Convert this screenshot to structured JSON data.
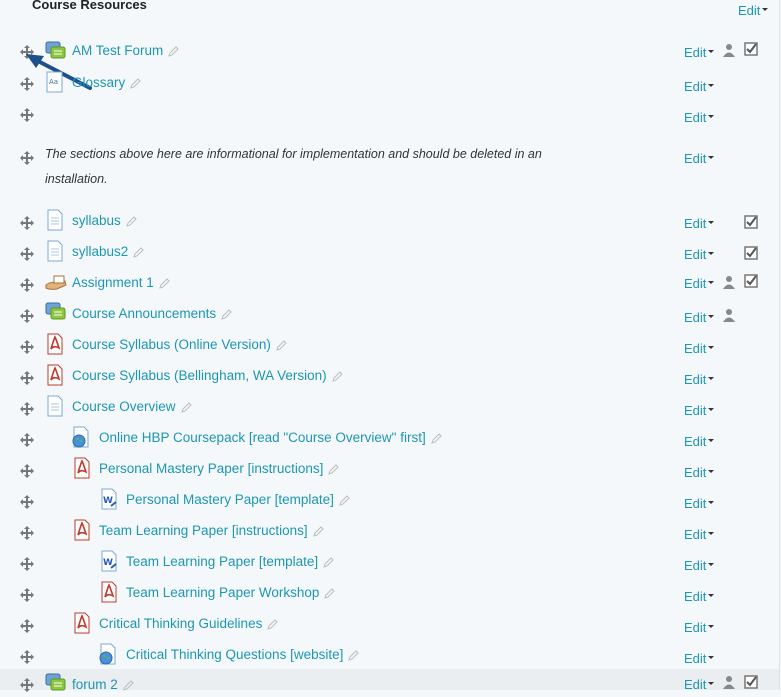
{
  "section": {
    "title": "Course Resources",
    "edit_label": "Edit"
  },
  "label_text": "The sections above here are informational for implementation and should be deleted in an installation.",
  "activities": [
    {
      "name": "AM Test Forum",
      "icon": "forum-icon",
      "edit": "Edit"
    },
    {
      "name": "Glossary",
      "icon": "glossary-icon",
      "edit": "Edit"
    },
    {
      "name": "",
      "icon": "",
      "edit": "Edit"
    },
    {
      "name": "syllabus",
      "icon": "page-icon",
      "edit": "Edit"
    },
    {
      "name": "syllabus2",
      "icon": "page-icon",
      "edit": "Edit"
    },
    {
      "name": "Assignment 1",
      "icon": "assignment-icon",
      "edit": "Edit"
    },
    {
      "name": "Course Announcements",
      "icon": "forum-icon",
      "edit": "Edit"
    },
    {
      "name": "Course Syllabus (Online Version)",
      "icon": "pdf-icon",
      "edit": "Edit"
    },
    {
      "name": "Course Syllabus (Bellingham, WA Version)",
      "icon": "pdf-icon",
      "edit": "Edit"
    },
    {
      "name": "Course Overview",
      "icon": "page-icon",
      "edit": "Edit"
    },
    {
      "name": "Online HBP Coursepack [read \"Course Overview\" first]",
      "icon": "url-icon",
      "edit": "Edit"
    },
    {
      "name": "Personal Mastery Paper [instructions]",
      "icon": "pdf-icon",
      "edit": "Edit"
    },
    {
      "name": "Personal Mastery Paper [template]",
      "icon": "word-icon",
      "edit": "Edit"
    },
    {
      "name": "Team Learning Paper [instructions]",
      "icon": "pdf-icon",
      "edit": "Edit"
    },
    {
      "name": "Team Learning Paper [template]",
      "icon": "word-icon",
      "edit": "Edit"
    },
    {
      "name": "Team Learning Paper Workshop",
      "icon": "pdf-icon",
      "edit": "Edit"
    },
    {
      "name": "Critical Thinking Guidelines",
      "icon": "pdf-icon",
      "edit": "Edit"
    },
    {
      "name": "Critical Thinking Questions [website]",
      "icon": "url-icon",
      "edit": "Edit"
    },
    {
      "name": "forum 2",
      "icon": "forum-icon",
      "edit": "Edit"
    }
  ],
  "colors": {
    "link": "#1d96b2",
    "background": "#f5f8fa",
    "highlight_row": "#ebeef0",
    "pdf": "#c0392b",
    "forum": "#7ac143"
  }
}
